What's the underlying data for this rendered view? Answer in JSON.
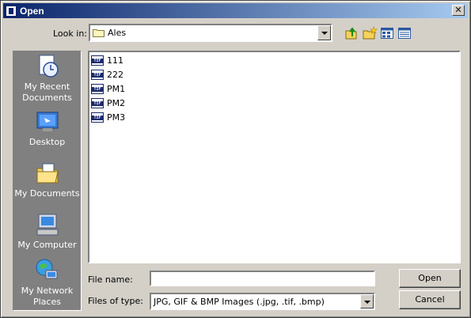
{
  "window": {
    "title": "Open",
    "close_glyph": "✕"
  },
  "lookin": {
    "label": "Look in:",
    "value": "Ales"
  },
  "toolbar": {
    "icons": [
      "up-one-level-icon",
      "new-folder-icon",
      "list-view-icon",
      "details-view-icon"
    ]
  },
  "places": [
    {
      "name": "recent",
      "label": "My Recent Documents",
      "icon": "recent-documents-icon"
    },
    {
      "name": "desktop",
      "label": "Desktop",
      "icon": "desktop-icon"
    },
    {
      "name": "documents",
      "label": "My Documents",
      "icon": "my-documents-icon"
    },
    {
      "name": "computer",
      "label": "My Computer",
      "icon": "my-computer-icon"
    },
    {
      "name": "network",
      "label": "My Network Places",
      "icon": "network-places-icon"
    }
  ],
  "files": [
    {
      "name": "111",
      "icon_text": "TIF"
    },
    {
      "name": "222",
      "icon_text": "TIF"
    },
    {
      "name": "PM1",
      "icon_text": "TIF"
    },
    {
      "name": "PM2",
      "icon_text": "TIF"
    },
    {
      "name": "PM3",
      "icon_text": "TIF"
    }
  ],
  "filename": {
    "label": "File name:",
    "value": ""
  },
  "filetype": {
    "label": "Files of type:",
    "value": "JPG, GIF & BMP Images (.jpg, .tif, .bmp)"
  },
  "buttons": {
    "open": "Open",
    "cancel": "Cancel"
  }
}
